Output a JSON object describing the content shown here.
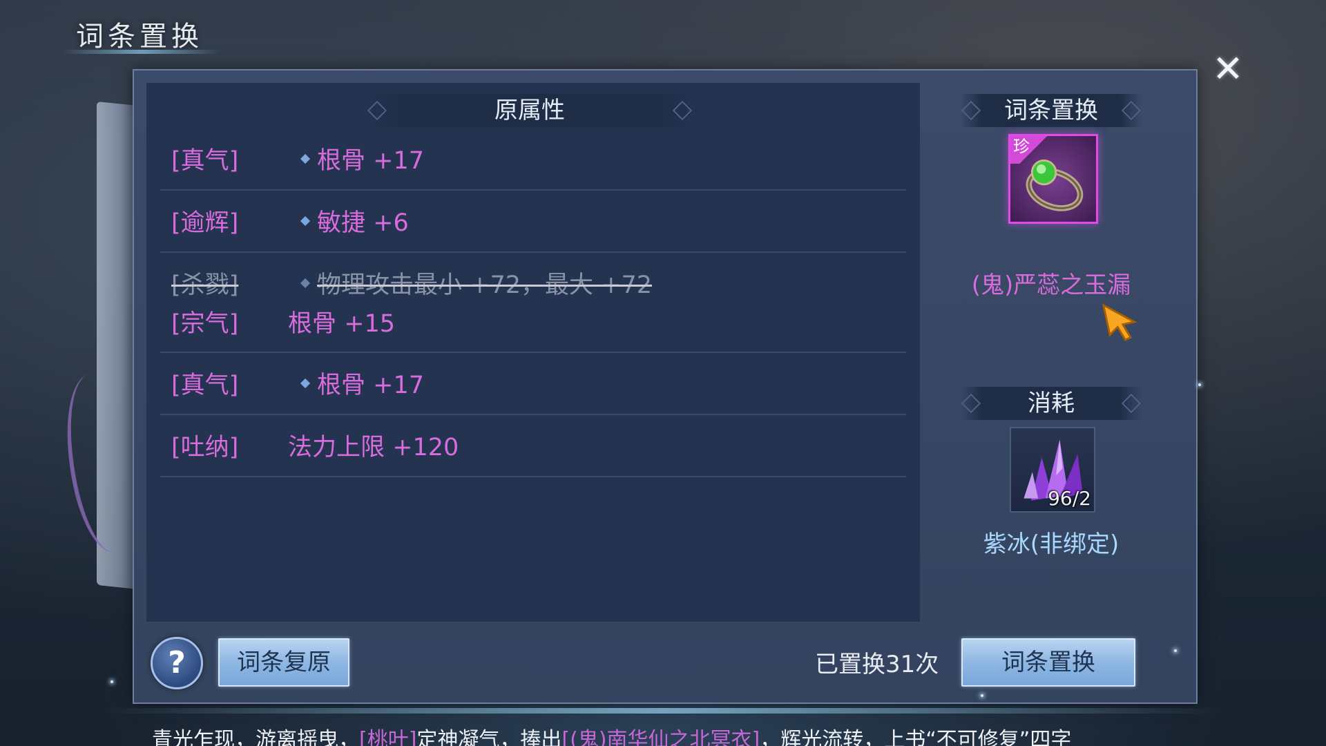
{
  "window": {
    "title": "词条置换",
    "close_symbol": "✕"
  },
  "original": {
    "header": "原属性",
    "rows": [
      {
        "tag": "[真气]",
        "value": "根骨 +17",
        "bullet": true,
        "struck": false
      },
      {
        "tag": "[逾辉]",
        "value": "敏捷 +6",
        "bullet": true,
        "struck": false
      },
      {
        "tag": "[杀戮]",
        "value": "物理攻击最小 +72，最大 +72",
        "bullet": true,
        "struck": true
      },
      {
        "tag": "[宗气]",
        "value": "根骨 +15",
        "bullet": false,
        "struck": false
      },
      {
        "tag": "[真气]",
        "value": "根骨 +17",
        "bullet": true,
        "struck": false
      },
      {
        "tag": "[吐纳]",
        "value": "法力上限 +120",
        "bullet": false,
        "struck": false
      }
    ]
  },
  "swap_panel": {
    "header": "词条置换",
    "item": {
      "rarity_tag": "珍",
      "name": "(鬼)严蕊之玉漏",
      "icon": "jade-ring-icon"
    }
  },
  "cost_panel": {
    "header": "消耗",
    "item": {
      "name": "紫冰(非绑定)",
      "count": "96/2",
      "icon": "purple-crystal-icon"
    }
  },
  "footer": {
    "help_label": "?",
    "restore_label": "词条复原",
    "swap_count_text": "已置换31次",
    "swap_label": "词条置换"
  },
  "ticker": {
    "parts": [
      {
        "text": "青光乍现，游离摇曳，",
        "highlight": false
      },
      {
        "text": "[桃叶]",
        "highlight": true
      },
      {
        "text": "定神凝气，捧出",
        "highlight": false
      },
      {
        "text": "[(鬼)南华仙之北冥衣]",
        "highlight": true
      },
      {
        "text": "，辉光流转，上书“不可修复”四字",
        "highlight": false
      }
    ]
  },
  "colors": {
    "accent_pink": "#d96cdc",
    "accent_blue": "#a9d8ff",
    "button_blue": "#8eb7e3"
  }
}
